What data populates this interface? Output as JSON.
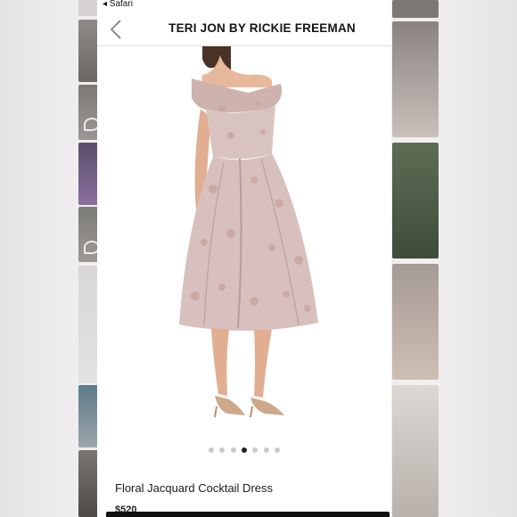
{
  "status_bar": {
    "back_app": "◂ Safari"
  },
  "header": {
    "brand_title": "TERI JON BY RICKIE FREEMAN",
    "back_icon": "chevron-left-icon"
  },
  "carousel": {
    "total": 7,
    "active_index": 3
  },
  "product": {
    "name": "Floral Jacquard Cocktail Dress",
    "price_partial": "$520"
  },
  "colors": {
    "dress": "#d9c3c1",
    "dress_shadow": "#b89e9b",
    "dress_accent": "#caa29c",
    "skin": "#e8b89c",
    "hair": "#4a3326",
    "sandal": "#cda88a",
    "dot_inactive": "#c9c9c9",
    "dot_active": "#222222",
    "cta": "#111111"
  }
}
